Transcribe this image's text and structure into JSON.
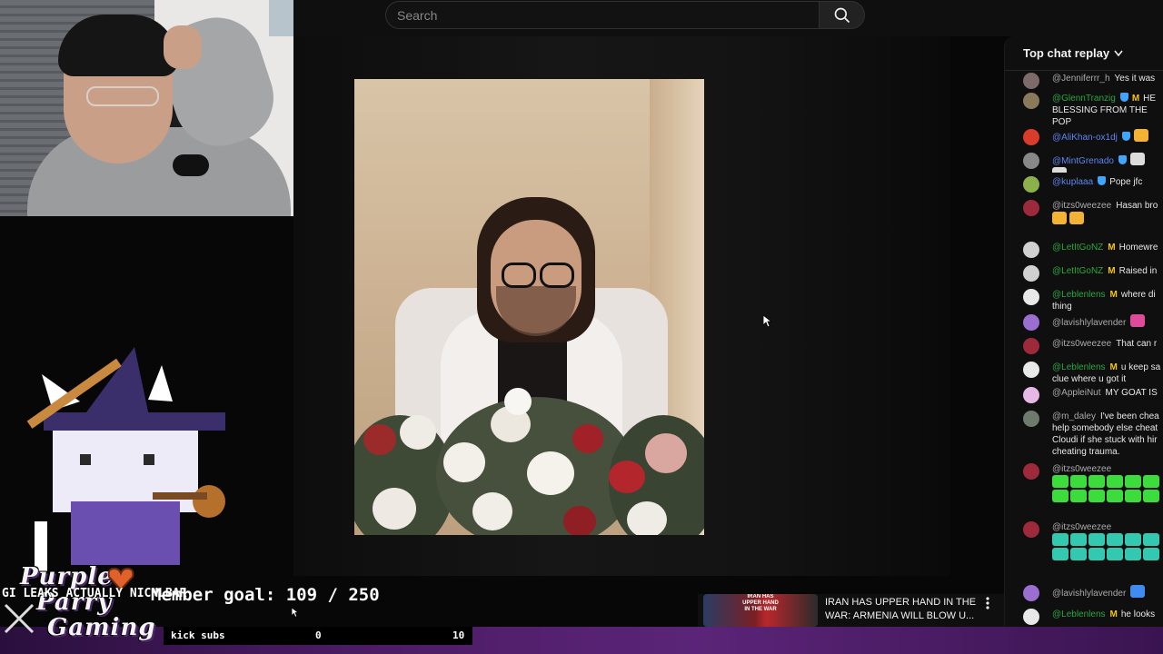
{
  "search": {
    "placeholder": "Search"
  },
  "chat": {
    "header": "Top chat replay",
    "messages": [
      {
        "author": "@Jenniferrr_h",
        "text": "Yes it was",
        "kind": "normal",
        "avatar": "#7d6b6b"
      },
      {
        "author": "@GlennTranzig",
        "text": "HE BLESSING FROM THE POP",
        "kind": "member",
        "badge": "verified-m",
        "avatar": "#8a7a5c"
      },
      {
        "author": "@AliKhan-ox1dj",
        "text": "",
        "kind": "mod",
        "badge": "verified",
        "avatar": "#d93c2b",
        "emotes": [
          "#f2b233"
        ]
      },
      {
        "author": "@MintGrenado",
        "text": "",
        "kind": "mod",
        "badge": "verified",
        "avatar": "#888888",
        "emotes": [
          "#dcdcdc",
          "#dcdcdc"
        ]
      },
      {
        "author": "@kuplaaa",
        "text": "Pope jfc",
        "kind": "mod",
        "badge": "verified",
        "avatar": "#8cb04a"
      },
      {
        "author": "@itzs0weezee",
        "text": "Hasan bro",
        "kind": "normal",
        "avatar": "#9c2a3a",
        "emotes_line2": [
          "#f2b233",
          "#f2b233"
        ]
      },
      {
        "author": "@LetItGoNZ",
        "text": "Homewre",
        "kind": "member",
        "badge": "m",
        "avatar": "#d0d0d0"
      },
      {
        "author": "@LetItGoNZ",
        "text": "Raised in",
        "kind": "member",
        "badge": "m",
        "avatar": "#d0d0d0"
      },
      {
        "author": "@Leblenlens",
        "text": "where di thing",
        "kind": "member",
        "badge": "m",
        "avatar": "#e8e8e8"
      },
      {
        "author": "@lavishlylavender",
        "text": "",
        "kind": "normal",
        "avatar": "#9a6fd0",
        "emotes": [
          "#e04a9a"
        ]
      },
      {
        "author": "@itzs0weezee",
        "text": "That can r",
        "kind": "normal",
        "avatar": "#9c2a3a"
      },
      {
        "author": "@Leblenlens",
        "text": "u keep sa clue where u got it",
        "kind": "member",
        "badge": "m",
        "avatar": "#e8e8e8"
      },
      {
        "author": "@AppleiNut",
        "text": "MY GOAT IS",
        "kind": "normal",
        "avatar": "#e6b8e6"
      },
      {
        "author": "@m_daley",
        "text": "I've been chea help somebody else cheat Cloudi if she stuck with hir cheating trauma.",
        "kind": "normal",
        "avatar": "#6f7a6f"
      },
      {
        "author": "@itzs0weezee",
        "text": "",
        "kind": "normal",
        "avatar": "#9c2a3a",
        "emote_grid": "#3ddc3d"
      },
      {
        "author": "@itzs0weezee",
        "text": "",
        "kind": "normal",
        "avatar": "#9c2a3a",
        "emote_grid": "#33c9b0"
      },
      {
        "author": "@lavishlylavender",
        "text": "",
        "kind": "normal",
        "avatar": "#9a6fd0",
        "emotes": [
          "#3e8cf0"
        ]
      },
      {
        "author": "@Leblenlens",
        "text": "he looks",
        "kind": "member",
        "badge": "m",
        "avatar": "#e8e8e8"
      }
    ]
  },
  "overlay": {
    "brand_line1": "Purple",
    "brand_line2": "Parry",
    "brand_line3": "Gaming",
    "ticker": "GI LEAKS ACTUALLY NICHLBAR",
    "member_goal": "Member goal: 109 / 250",
    "kick_label": "kick subs",
    "kick_current": "0",
    "kick_target": "10"
  },
  "suggestion": {
    "thumb_tag": "IRAN HAS UPPER HAND IN THE WAR",
    "title": "IRAN HAS UPPER HAND IN THE WAR: ARMENIA WILL BLOW U..."
  }
}
